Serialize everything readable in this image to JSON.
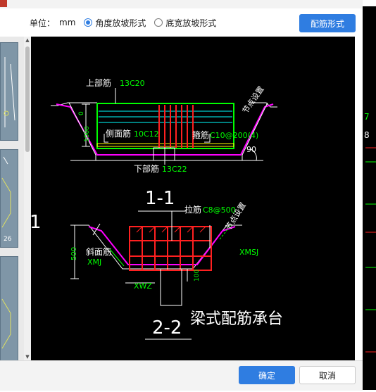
{
  "toolbar": {
    "unit_label": "单位：",
    "unit_value": "mm",
    "option_angle": "角度放坡形式",
    "option_width": "底宽放坡形式",
    "selected_option": "angle",
    "rebar_form_button": "配筋形式"
  },
  "drawing": {
    "section1": {
      "title": "1-1",
      "top_rebar_label": "上部筋",
      "top_rebar_value": "13C20",
      "side_rebar_label": "侧面筋",
      "side_rebar_value": "10C12",
      "stirrup_label": "箍筋",
      "stirrup_value": "C10@200(4)",
      "bottom_rebar_label": "下部筋",
      "bottom_rebar_value": "13C22",
      "node_setting": "节点设置",
      "angle": "90",
      "height_dim": "1000",
      "dim_zero": "0"
    },
    "section2": {
      "title": "2-2",
      "tie_rebar_label": "拉筋",
      "tie_rebar_value": "C8@500",
      "slope_rebar_label": "斜面筋",
      "slope_rebar_code": "XMJ",
      "xmsj": "XMSJ",
      "xwz": "XWZ",
      "height_dim": "500",
      "dim_100": "100",
      "node_setting": "节点设置"
    },
    "caption": "梁式配筋承台",
    "left_label": "1"
  },
  "thumbnails": [
    {
      "text": ""
    },
    {
      "text": "26"
    },
    {
      "text": ""
    }
  ],
  "footer": {
    "ok_button": "确定",
    "cancel_button": "取消"
  },
  "colors": {
    "accent": "#2f7de1",
    "preview_bg": "#000000",
    "rebar_red": "#ff2020",
    "outline_green": "#00ff00",
    "cyan": "#00ffff",
    "magenta": "#ff00ff",
    "yellow": "#ffff00"
  }
}
